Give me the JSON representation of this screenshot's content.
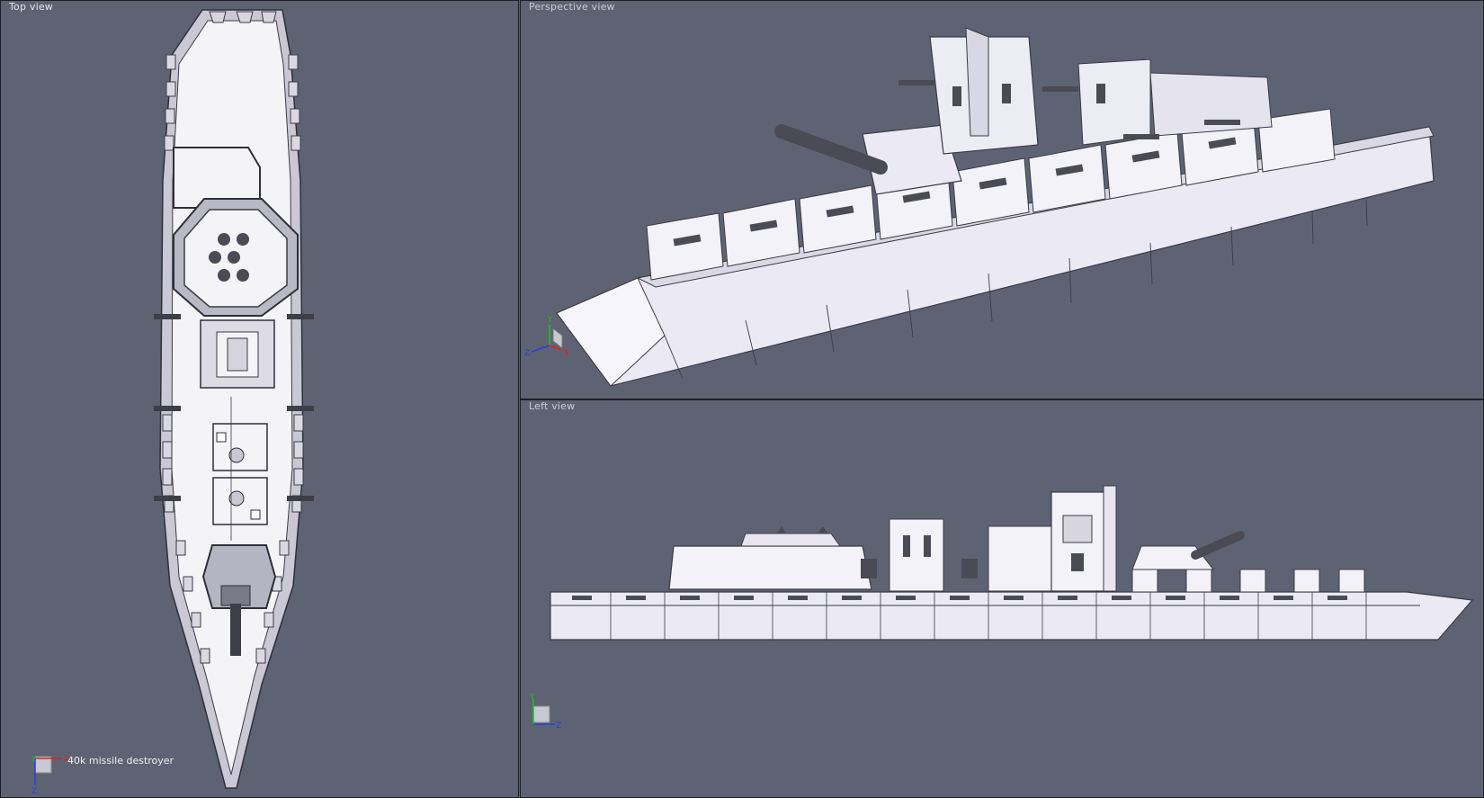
{
  "viewports": {
    "top": {
      "title": "Top view",
      "caption": "40k missile destroyer"
    },
    "perspective": {
      "title": "Perspective view"
    },
    "left": {
      "title": "Left view"
    }
  },
  "axes": {
    "top": {
      "x": "X",
      "y": "Y",
      "z": "Z"
    },
    "perspective": {
      "x": "X",
      "y": "Y",
      "z": "Z"
    },
    "left": {
      "y": "Y",
      "z": "Z"
    }
  },
  "colors": {
    "background": "#5e6373",
    "hull_fill": "#f2f1f7",
    "hull_shade": "#cfcddc",
    "edge": "#3a3b45",
    "axis_x": "#e02020",
    "axis_y": "#20c020",
    "axis_z": "#2040e0"
  }
}
